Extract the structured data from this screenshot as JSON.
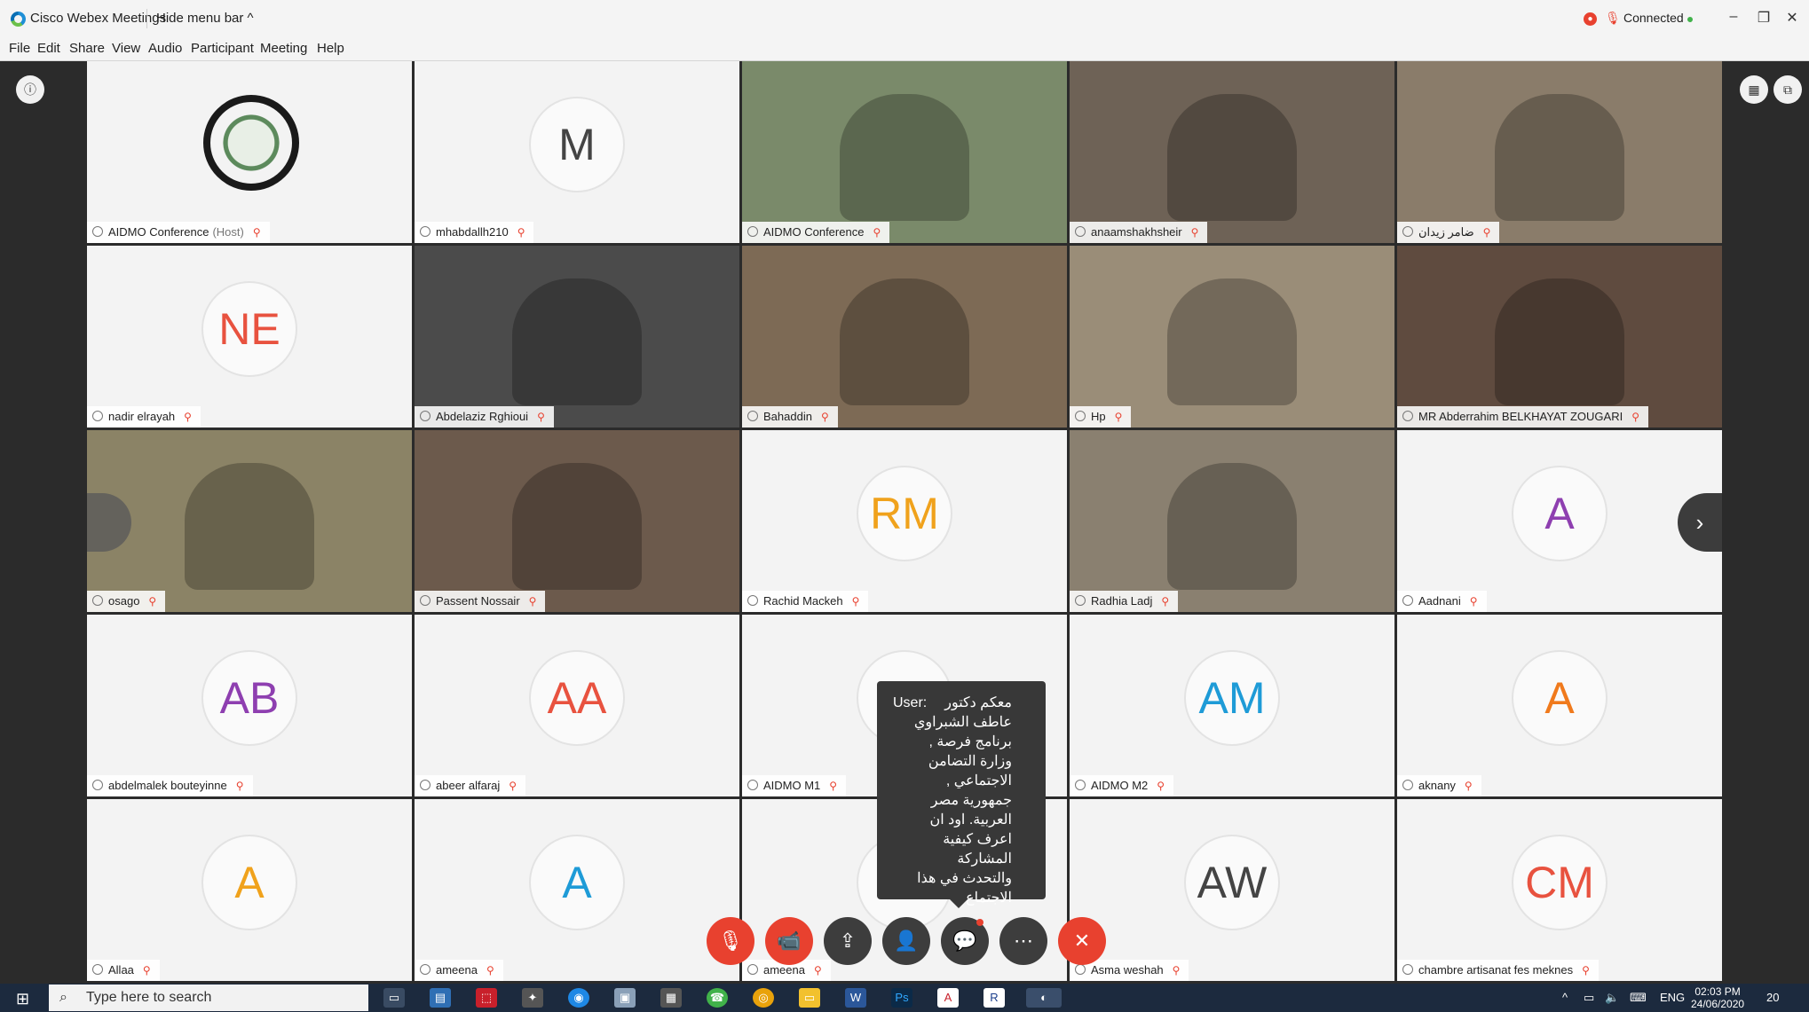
{
  "titlebar": {
    "app_title": "Cisco Webex Meetings",
    "hide_menu": "Hide menu bar ^",
    "status": "Connected"
  },
  "menu": [
    "File",
    "Edit",
    "Share",
    "View",
    "Audio",
    "Participant",
    "Meeting",
    "Help"
  ],
  "tiles": [
    {
      "name": "AIDMO Conference",
      "host": "(Host)",
      "type": "logo"
    },
    {
      "name": "mhabdallh210",
      "initials": "M",
      "color": "#444444"
    },
    {
      "name": "AIDMO Conference",
      "type": "video"
    },
    {
      "name": "anaamshakhsheir",
      "type": "video"
    },
    {
      "name": "ضامر زيدان",
      "type": "video"
    },
    {
      "name": "nadir elrayah",
      "initials": "NE",
      "color": "#e8523f"
    },
    {
      "name": "Abdelaziz Rghioui",
      "type": "video"
    },
    {
      "name": "Bahaddin",
      "type": "video"
    },
    {
      "name": "Hp",
      "type": "video"
    },
    {
      "name": "MR Abderrahim BELKHAYAT ZOUGARI",
      "type": "video"
    },
    {
      "name": "osago",
      "type": "video"
    },
    {
      "name": "Passent Nossair",
      "type": "video"
    },
    {
      "name": "Rachid Mackeh",
      "initials": "RM",
      "color": "#f0a21c"
    },
    {
      "name": "Radhia Ladj",
      "type": "video"
    },
    {
      "name": "Aadnani",
      "initials": "A",
      "color": "#8e3fb0"
    },
    {
      "name": "abdelmalek bouteyinne",
      "initials": "AB",
      "color": "#8e3fb0"
    },
    {
      "name": "abeer alfaraj",
      "initials": "AA",
      "color": "#e8523f"
    },
    {
      "name": "AIDMO M1",
      "initials": "A",
      "color": "#41b24a"
    },
    {
      "name": "AIDMO M2",
      "initials": "AM",
      "color": "#1e9bd7"
    },
    {
      "name": "aknany",
      "initials": "A",
      "color": "#f07a1c"
    },
    {
      "name": "Allaa",
      "initials": "A",
      "color": "#f0a21c"
    },
    {
      "name": "ameena",
      "initials": "A",
      "color": "#1e9bd7"
    },
    {
      "name": "ameena",
      "initials": "",
      "color": "#444444"
    },
    {
      "name": "Asma weshah",
      "initials": "AW",
      "color": "#444444"
    },
    {
      "name": "chambre artisanat fes meknes",
      "initials": "CM",
      "color": "#e8523f"
    }
  ],
  "chat": {
    "user": "User:",
    "text": "معكم دكتور عاطف الشبراوي برنامج فرصة , وزارة التضامن الاجتماعي , جمهورية مصر العربية. اود ان اعرف كيفية المشاركة والتحدث في هذا الاجتماع"
  },
  "controls": [
    "mute",
    "stop-video",
    "share",
    "participants",
    "chat",
    "more",
    "leave"
  ],
  "taskbar": {
    "search_placeholder": "Type here to search",
    "lang": "ENG",
    "time": "02:03 PM",
    "date": "24/06/2020",
    "notif_count": "20"
  }
}
